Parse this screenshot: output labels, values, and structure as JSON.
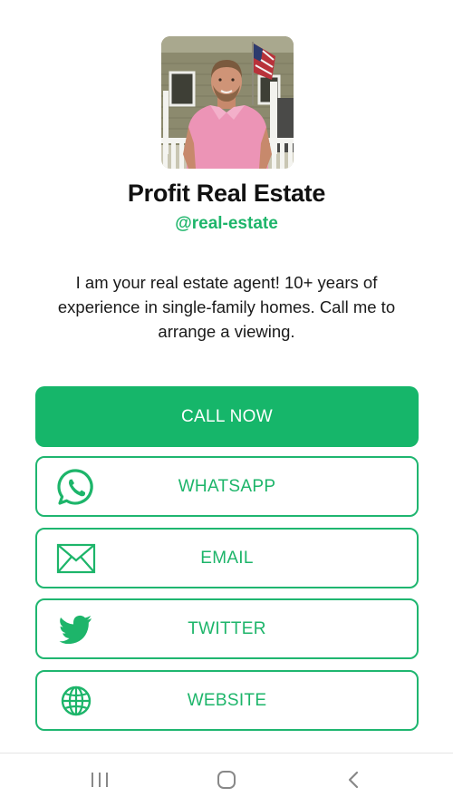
{
  "profile": {
    "name": "Profit Real Estate",
    "handle": "@real-estate",
    "bio": "I am your real estate agent! 10+ years of experience in single-family homes. Call me to arrange a viewing."
  },
  "buttons": {
    "call_now": "CALL NOW",
    "whatsapp": "WHATSAPP",
    "email": "EMAIL",
    "twitter": "TWITTER",
    "website": "WEBSITE"
  },
  "icons": {
    "whatsapp": "whatsapp-icon",
    "email": "envelope-icon",
    "twitter": "twitter-bird-icon",
    "website": "globe-icon",
    "nav_recents": "recents-icon",
    "nav_home": "home-icon",
    "nav_back": "back-icon"
  },
  "colors": {
    "accent": "#16b66a",
    "accent_text": "#1db56a",
    "text": "#111111",
    "background": "#ffffff"
  }
}
